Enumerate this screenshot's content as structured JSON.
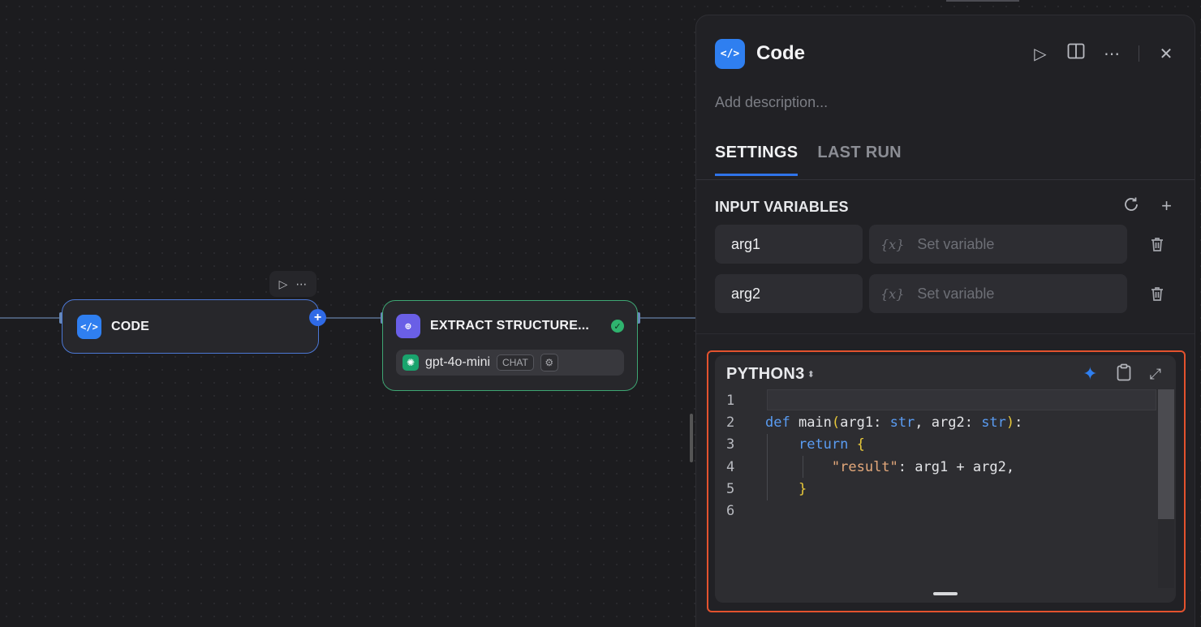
{
  "canvas": {
    "node_toolbar": {
      "run_icon": "play-icon",
      "more_icon": "ellipsis-icon"
    },
    "code_node": {
      "title": "CODE",
      "icon": "code-icon"
    },
    "extract_node": {
      "title": "EXTRACT STRUCTURE...",
      "icon": "extract-icon",
      "status": "success",
      "model": {
        "name": "gpt-4o-mini",
        "mode": "CHAT",
        "logo": "openai-logo"
      }
    }
  },
  "panel": {
    "title": "Code",
    "description_placeholder": "Add description...",
    "tabs": [
      {
        "label": "SETTINGS",
        "active": true
      },
      {
        "label": "LAST RUN",
        "active": false
      }
    ],
    "input_variables": {
      "title": "INPUT VARIABLES",
      "rows": [
        {
          "name": "arg1",
          "value_placeholder": "Set variable",
          "value_icon": "{x}"
        },
        {
          "name": "arg2",
          "value_placeholder": "Set variable",
          "value_icon": "{x}"
        }
      ]
    },
    "editor": {
      "language": "PYTHON3",
      "line_numbers": [
        "1",
        "2",
        "3",
        "4",
        "5",
        "6"
      ]
    }
  },
  "colors": {
    "accent": "#2f7ff0",
    "success": "#2fb36e",
    "highlight_border": "#e3522e"
  }
}
